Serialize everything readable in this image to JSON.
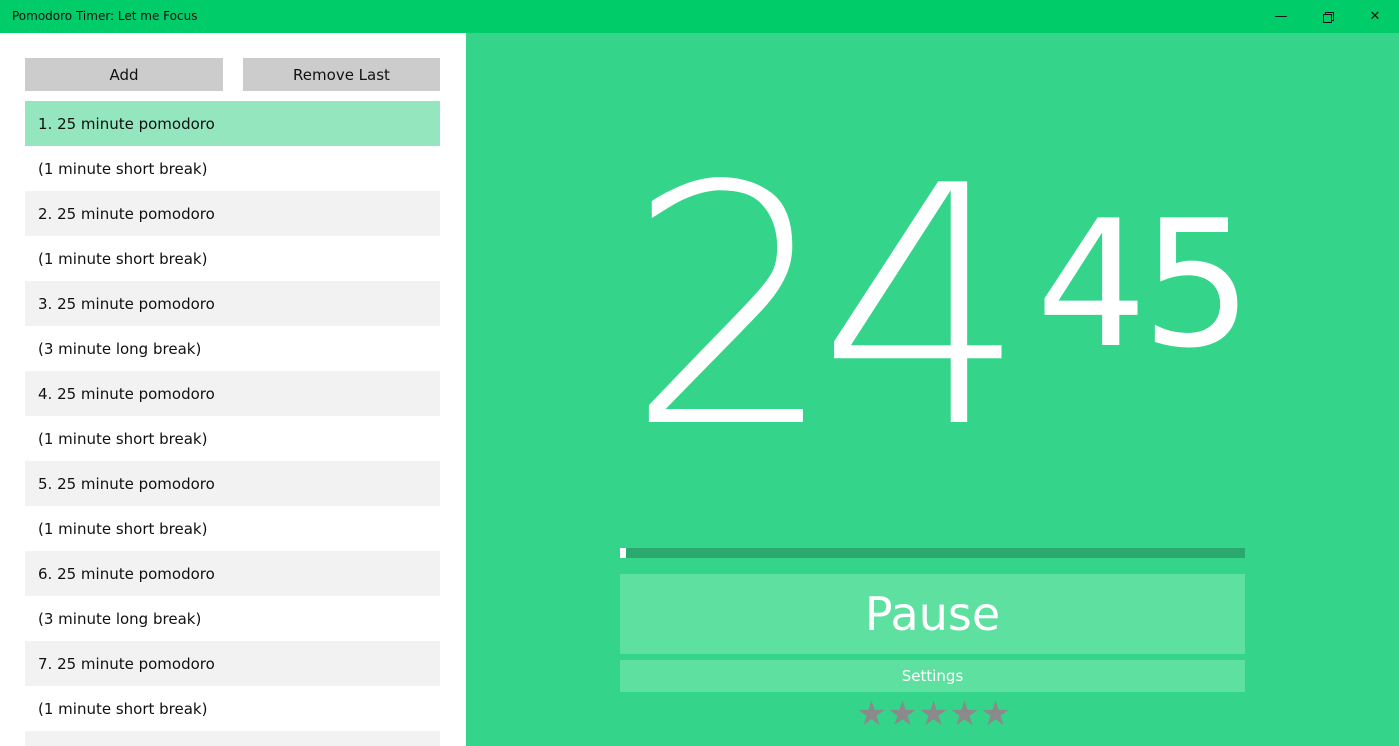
{
  "window": {
    "title": "Pomodoro Timer: Let me Focus",
    "minimize_glyph": "—",
    "close_glyph": "✕"
  },
  "controls": {
    "add_label": "Add",
    "remove_label": "Remove Last"
  },
  "queue": [
    {
      "label": "1. 25 minute pomodoro",
      "state": "active"
    },
    {
      "label": "(1 minute short break)",
      "state": "plain"
    },
    {
      "label": "2. 25 minute pomodoro",
      "state": "alt"
    },
    {
      "label": "(1 minute short break)",
      "state": "plain"
    },
    {
      "label": "3. 25 minute pomodoro",
      "state": "alt"
    },
    {
      "label": "(3 minute long break)",
      "state": "plain"
    },
    {
      "label": "4. 25 minute pomodoro",
      "state": "alt"
    },
    {
      "label": "(1 minute short break)",
      "state": "plain"
    },
    {
      "label": "5. 25 minute pomodoro",
      "state": "alt"
    },
    {
      "label": "(1 minute short break)",
      "state": "plain"
    },
    {
      "label": "6. 25 minute pomodoro",
      "state": "alt"
    },
    {
      "label": "(3 minute long break)",
      "state": "plain"
    },
    {
      "label": "7. 25 minute pomodoro",
      "state": "alt"
    },
    {
      "label": "(1 minute short break)",
      "state": "plain"
    },
    {
      "label": "",
      "state": "alt"
    }
  ],
  "timer": {
    "minutes": "24",
    "seconds": "45",
    "progress_fraction": 0.01
  },
  "actions": {
    "pause_label": "Pause",
    "settings_label": "Settings"
  },
  "rating": {
    "stars": 5,
    "star_glyph": "★"
  },
  "colors": {
    "titlebar": "#00cc6a",
    "timer_background": "#34d58a",
    "active_item": "#93e6bd",
    "button_accent": "#5ee0a1",
    "star": "#8a8a8a"
  }
}
